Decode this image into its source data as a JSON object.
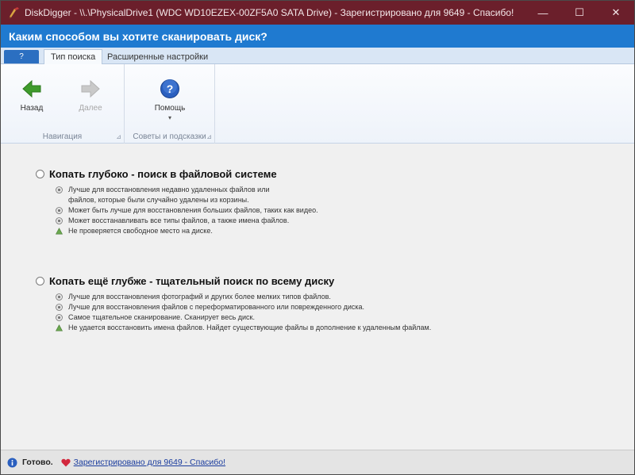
{
  "window": {
    "title": "DiskDigger - \\\\.\\PhysicalDrive1 (WDC WD10EZEX-00ZF5A0 SATA Drive) - Зарегистрировано для  9649 - Спасибо!",
    "controls": {
      "minimize": "—",
      "maximize": "☐",
      "close": "✕"
    }
  },
  "header": {
    "title": "Каким способом вы хотите сканировать диск?"
  },
  "tabs": {
    "help": "?",
    "items": [
      {
        "label": "Тип поиска",
        "active": true
      },
      {
        "label": "Расширенные настройки",
        "active": false
      }
    ]
  },
  "ribbon": {
    "navigation": {
      "back_label": "Назад",
      "next_label": "Далее",
      "group_label": "Навигация"
    },
    "help": {
      "help_label": "Помощь",
      "dropdown": "▾",
      "group_label": "Советы и подсказки"
    },
    "launcher": "⊿"
  },
  "options": [
    {
      "title": "Копать глубоко - поиск в файловой системе",
      "bullets": [
        {
          "type": "plus",
          "text": "Лучше для восстановления недавно удаленных файлов или\nфайлов, которые были случайно удалены из корзины."
        },
        {
          "type": "minus",
          "text": "Может быть лучше для восстановления больших файлов, таких как видео."
        },
        {
          "type": "plus",
          "text": "Может восстанавливать все типы файлов, а также имена файлов."
        },
        {
          "type": "warning",
          "text": "Не проверяется свободное место на диске."
        }
      ]
    },
    {
      "title": "Копать ещё глубже - тщательный поиск по всему диску",
      "bullets": [
        {
          "type": "plus",
          "text": "Лучше для восстановления фотографий и других более мелких типов файлов."
        },
        {
          "type": "plus",
          "text": "Лучше для восстановления файлов с переформатированного или поврежденного диска."
        },
        {
          "type": "plus",
          "text": "Самое тщательное сканирование. Сканирует весь диск."
        },
        {
          "type": "warning",
          "text": "Не удается восстановить имена файлов. Найдет существующие файлы в дополнение к удаленным файлам."
        }
      ]
    }
  ],
  "status": {
    "text": "Готово.",
    "link": "Зарегистрировано для  9649 - Спасибо!"
  },
  "colors": {
    "titlebar": "#6b1f2b",
    "header": "#1f7ad0",
    "back_arrow": "#3f9b2c",
    "help_icon": "#2a5fbf"
  }
}
